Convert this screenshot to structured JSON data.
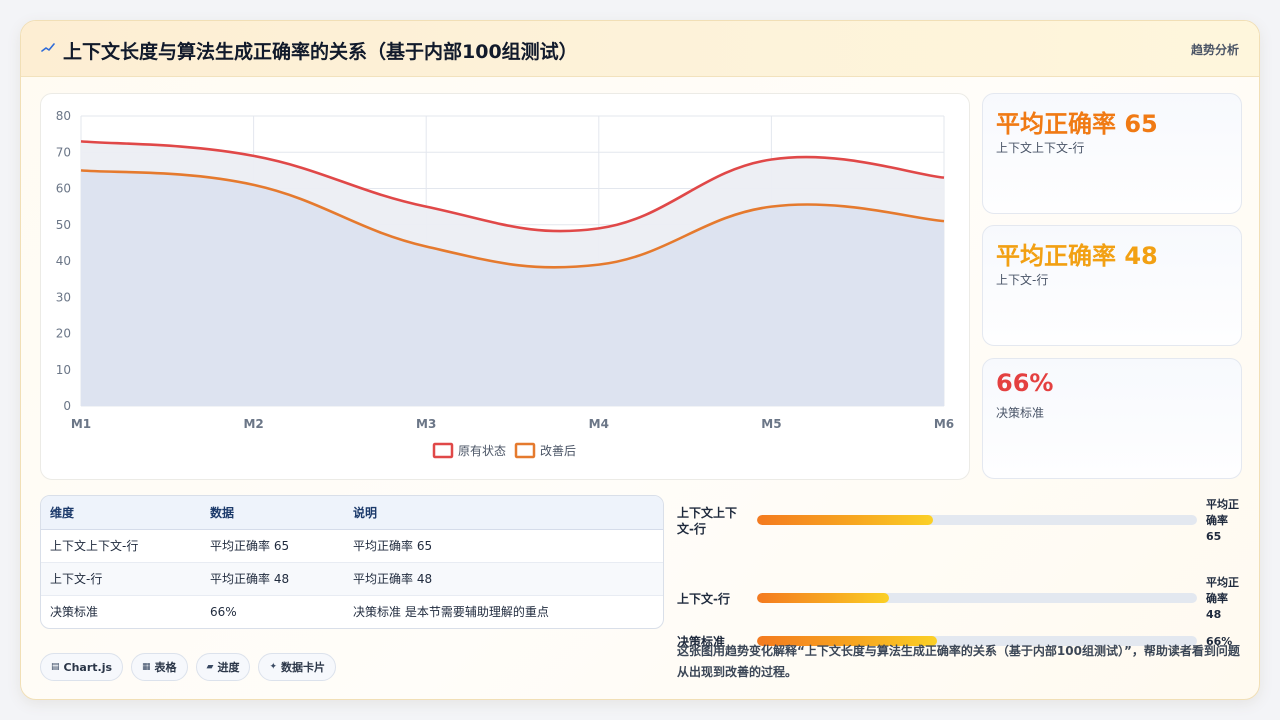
{
  "header": {
    "title": "上下文长度与算法生成正确率的关系（基于内部100组测试）",
    "tag": "趋势分析",
    "accent": "#2f6bd8"
  },
  "chart_data": {
    "type": "area",
    "categories": [
      "M1",
      "M2",
      "M3",
      "M4",
      "M5",
      "M6"
    ],
    "series": [
      {
        "name": "原有状态",
        "values": [
          73,
          69,
          55,
          49,
          68,
          63
        ],
        "color": "#e04848",
        "fill": "#eceef3"
      },
      {
        "name": "改善后",
        "values": [
          65,
          61,
          44,
          39,
          55,
          51
        ],
        "color": "#e57a2e",
        "fill": "#dce2ef"
      }
    ],
    "ylim": [
      0,
      80
    ],
    "yticks": [
      0,
      10,
      20,
      30,
      40,
      50,
      60,
      70,
      80
    ],
    "grid": true,
    "legend": "bottom"
  },
  "stats": [
    {
      "value": "平均正确率 65",
      "label": "上下文上下文-行",
      "color": "#f07a14"
    },
    {
      "value": "平均正确率 48",
      "label": "上下文-行",
      "color": "#f2a013"
    },
    {
      "value": "66%",
      "label": "决策标准",
      "color": "#e44040"
    }
  ],
  "table": {
    "headers": [
      "维度",
      "数据",
      "说明"
    ],
    "rows": [
      [
        "上下文上下文-行",
        "平均正确率 65",
        "平均正确率 65"
      ],
      [
        "上下文-行",
        "平均正确率 48",
        "平均正确率 48"
      ],
      [
        "决策标准",
        "66%",
        "决策标准 是本节需要辅助理解的重点"
      ]
    ]
  },
  "chips": [
    {
      "icon": "▤",
      "label": "Chart.js"
    },
    {
      "icon": "▦",
      "label": "表格"
    },
    {
      "icon": "▰",
      "label": "进度"
    },
    {
      "icon": "✦",
      "label": "数据卡片"
    }
  ],
  "progress": [
    {
      "label": "上下文上下文-行",
      "value_text": "平均正确率 65",
      "fraction": 0.4
    },
    {
      "label": "上下文-行",
      "value_text": "平均正确率 48",
      "fraction": 0.3
    },
    {
      "label": "决策标准",
      "value_text": "66%",
      "fraction": 0.41
    }
  ],
  "caption": "这张图用趋势变化解释“上下文长度与算法生成正确率的关系（基于内部100组测试）”，帮助读者看到问题从出现到改善的过程。"
}
